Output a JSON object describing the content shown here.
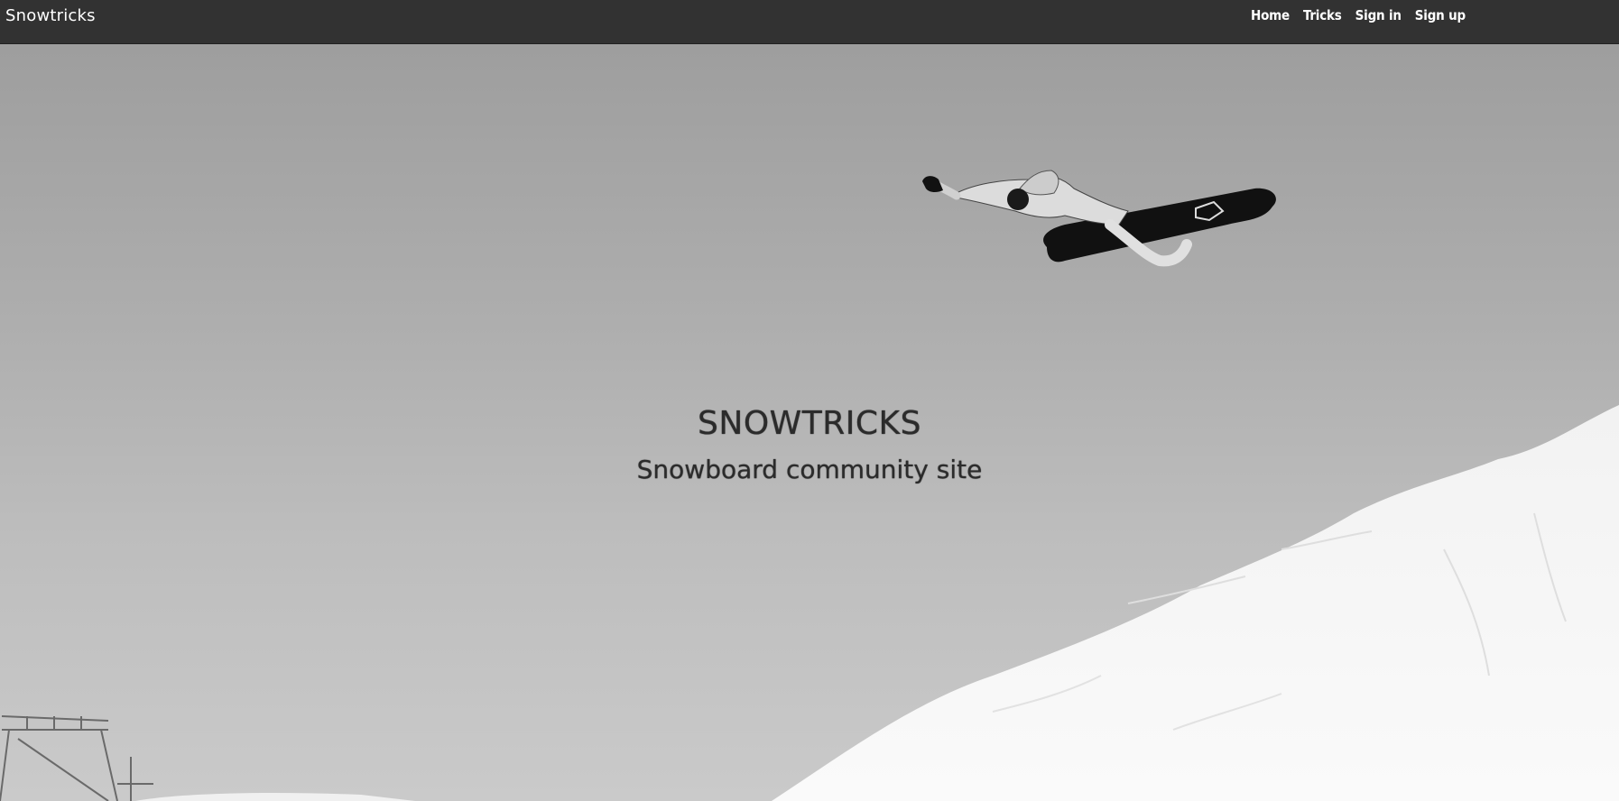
{
  "navbar": {
    "brand": "Snowtricks",
    "links": [
      {
        "label": "Home"
      },
      {
        "label": "Tricks"
      },
      {
        "label": "Sign in"
      },
      {
        "label": "Sign up"
      }
    ],
    "background_color": "#323232"
  },
  "hero": {
    "title": "SNOWTRICKS",
    "subtitle": "Snowboard community site",
    "image_description_icon": "snowboarder-photo"
  }
}
